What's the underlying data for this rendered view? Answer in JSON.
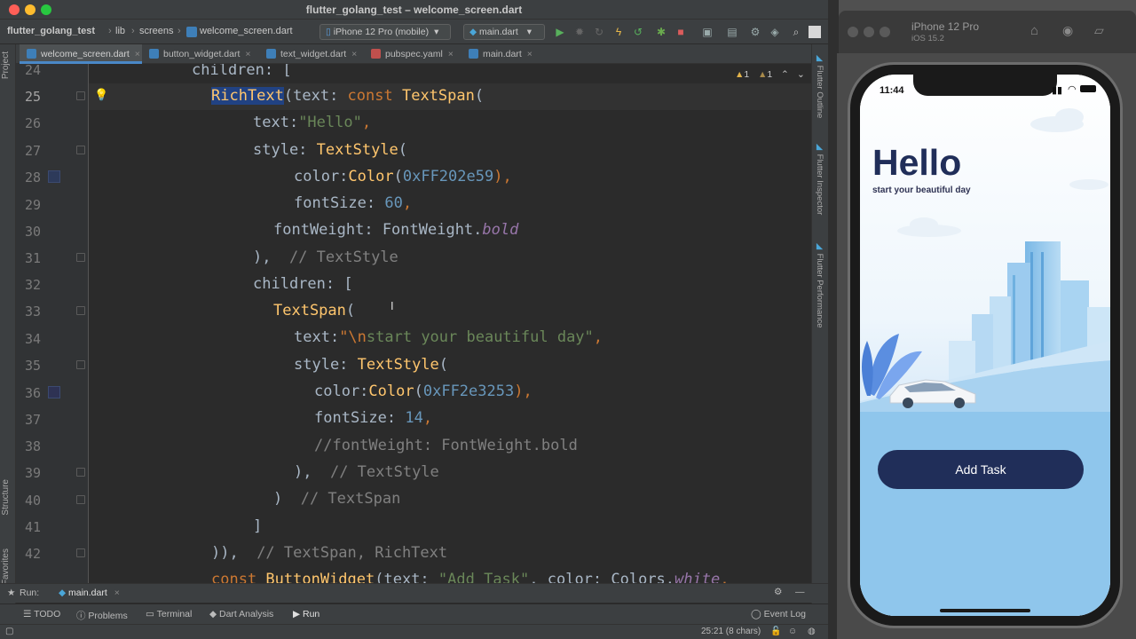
{
  "window": {
    "title": "flutter_golang_test – welcome_screen.dart"
  },
  "breadcrumbs": [
    "flutter_golang_test",
    "lib",
    "screens",
    "welcome_screen.dart"
  ],
  "toolbar": {
    "device": "iPhone 12 Pro (mobile)",
    "run_config": "main.dart"
  },
  "tabs": [
    {
      "label": "welcome_screen.dart",
      "active": true
    },
    {
      "label": "button_widget.dart"
    },
    {
      "label": "text_widget.dart"
    },
    {
      "label": "pubspec.yaml"
    },
    {
      "label": "main.dart"
    }
  ],
  "left_panels": {
    "project": "Project",
    "structure": "Structure",
    "favorites": "Favorites"
  },
  "right_panels": {
    "outline": "Flutter Outline",
    "inspector": "Flutter Inspector",
    "performance": "Flutter Performance"
  },
  "inspections": {
    "warnings": "1",
    "weak_warnings": "1"
  },
  "code": {
    "line_numbers": [
      "24",
      "25",
      "26",
      "27",
      "28",
      "29",
      "30",
      "31",
      "32",
      "33",
      "34",
      "35",
      "36",
      "37",
      "38",
      "39",
      "40",
      "41",
      "42"
    ],
    "current_line": "25",
    "l24": {
      "t1": "children: ["
    },
    "l25": {
      "t1": "RichText",
      "t2": "(text: ",
      "t3": "const ",
      "t4": "TextSpan",
      "t5": "("
    },
    "l26": {
      "t1": "text:",
      "t2": "\"Hello\"",
      "t3": ","
    },
    "l27": {
      "t1": "style: ",
      "t2": "TextStyle",
      "t3": "("
    },
    "l28": {
      "t1": "color:",
      "t2": "Color",
      "t3": "(",
      "t4": "0xFF202e59",
      "t5": "),"
    },
    "l29": {
      "t1": "fontSize: ",
      "t2": "60",
      "t3": ","
    },
    "l30": {
      "t1": "fontWeight: FontWeight.",
      "t2": "bold"
    },
    "l31": {
      "t1": "),  ",
      "t2": "// TextStyle"
    },
    "l32": {
      "t1": "children: ["
    },
    "l33": {
      "t1": "TextSpan",
      "t2": "("
    },
    "l34": {
      "t1": "text:",
      "t2": "\"\\n",
      "t3": "start your beautiful day\"",
      "t4": ","
    },
    "l35": {
      "t1": "style: ",
      "t2": "TextStyle",
      "t3": "("
    },
    "l36": {
      "t1": "color:",
      "t2": "Color",
      "t3": "(",
      "t4": "0xFF2e3253",
      "t5": "),"
    },
    "l37": {
      "t1": "fontSize: ",
      "t2": "14",
      "t3": ","
    },
    "l38": {
      "t1": "//fontWeight: FontWeight.bold"
    },
    "l39": {
      "t1": "),  ",
      "t2": "// TextStyle"
    },
    "l40": {
      "t1": ")  ",
      "t2": "// TextSpan"
    },
    "l41": {
      "t1": "]"
    },
    "l42": {
      "t1": ")),  ",
      "t2": "// TextSpan, RichText"
    },
    "l43": {
      "t1": "const ",
      "t2": "ButtonWidget",
      "t3": "(text: ",
      "t4": "\"Add Task\"",
      "t5": ", color: Colors.",
      "t6": "white",
      "t7": ", "
    }
  },
  "run_bar": {
    "label": "Run:",
    "config": "main.dart"
  },
  "tool_windows": [
    "TODO",
    "Problems",
    "Terminal",
    "Dart Analysis",
    "Run"
  ],
  "event_log": "Event Log",
  "status_bar": {
    "position": "25:21 (8 chars)"
  },
  "simulator": {
    "device_name": "iPhone 12 Pro",
    "os": "iOS 15.2",
    "time": "11:44",
    "app": {
      "title": "Hello",
      "subtitle": "start your beautiful day",
      "button": "Add Task",
      "title_color": "#202e59",
      "subtitle_color": "#2e3253",
      "button_color": "#202e59"
    }
  },
  "colors": {
    "keyword": "#cc7832",
    "function": "#ffc66d",
    "string": "#6a8759",
    "number": "#6897bb",
    "comment": "#808080",
    "accent": "#4a88c7"
  }
}
